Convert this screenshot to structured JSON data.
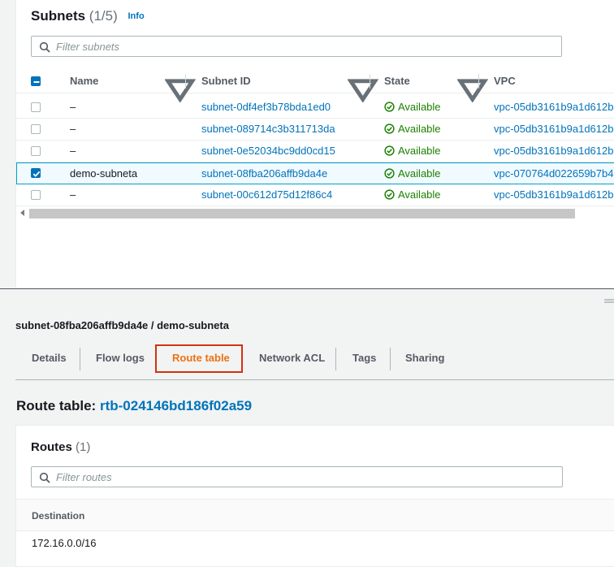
{
  "subnets": {
    "title": "Subnets",
    "count": "(1/5)",
    "info_label": "Info",
    "filter_placeholder": "Filter subnets",
    "columns": [
      "Name",
      "Subnet ID",
      "State",
      "VPC"
    ],
    "rows": [
      {
        "name": "–",
        "subnet_id": "subnet-0df4ef3b78bda1ed0",
        "state": "Available",
        "vpc": "vpc-05db3161b9a1d612b",
        "selected": false
      },
      {
        "name": "–",
        "subnet_id": "subnet-089714c3b311713da",
        "state": "Available",
        "vpc": "vpc-05db3161b9a1d612b",
        "selected": false
      },
      {
        "name": "–",
        "subnet_id": "subnet-0e52034bc9dd0cd15",
        "state": "Available",
        "vpc": "vpc-05db3161b9a1d612b",
        "selected": false
      },
      {
        "name": "demo-subneta",
        "subnet_id": "subnet-08fba206affb9da4e",
        "state": "Available",
        "vpc": "vpc-070764d022659b7b4",
        "selected": true
      },
      {
        "name": "–",
        "subnet_id": "subnet-00c612d75d12f86c4",
        "state": "Available",
        "vpc": "vpc-05db3161b9a1d612b",
        "selected": false
      }
    ]
  },
  "detail": {
    "title": "subnet-08fba206affb9da4e / demo-subneta",
    "tabs": [
      "Details",
      "Flow logs",
      "Route table",
      "Network ACL",
      "Tags",
      "Sharing"
    ],
    "active_tab": "Route table",
    "route_table_label": "Route table:",
    "route_table_id": "rtb-024146bd186f02a59"
  },
  "routes": {
    "title": "Routes",
    "count": "(1)",
    "filter_placeholder": "Filter routes",
    "columns": [
      "Destination"
    ],
    "rows": [
      {
        "destination": "172.16.0.0/16"
      }
    ]
  },
  "colors": {
    "link": "#0073bb",
    "available": "#1d8102",
    "active_tab": "#ec7211",
    "highlight_border": "#d13212",
    "checkbox_checked": "#0073bb"
  },
  "icons": [
    "search-icon",
    "sort-icon",
    "check-circle-icon",
    "checkbox-checked-icon",
    "scroll-left-icon",
    "resize-handle-icon"
  ]
}
